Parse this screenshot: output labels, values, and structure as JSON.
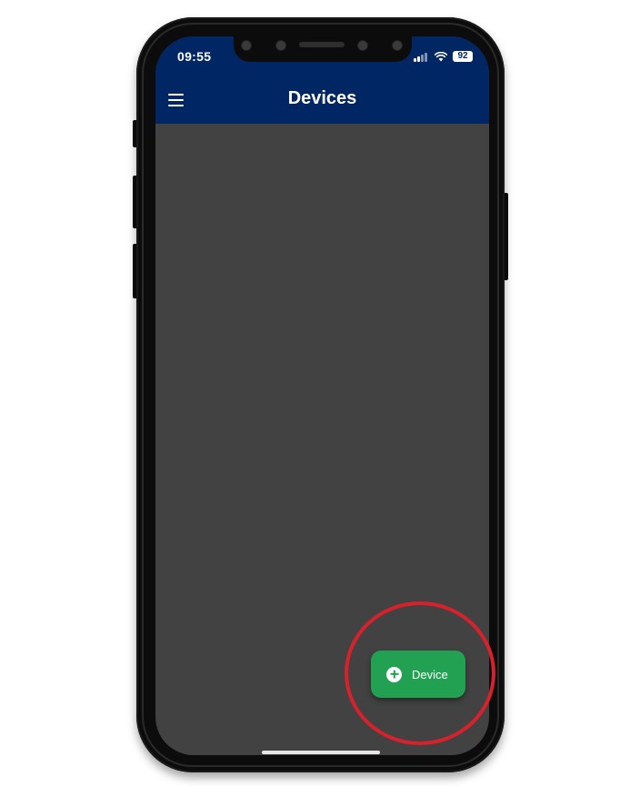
{
  "status_bar": {
    "time": "09:55",
    "battery": "92",
    "icons": [
      "cellular-signal-icon",
      "wifi-icon",
      "battery-icon"
    ]
  },
  "app_bar": {
    "title": "Devices",
    "menu_icon": "hamburger-menu-icon"
  },
  "fab": {
    "label": "Device",
    "icon": "add-circle-icon"
  },
  "colors": {
    "app_bar": "#002663",
    "screen_background": "#424242",
    "fab": "#22a152",
    "highlight": "#d7212c"
  }
}
